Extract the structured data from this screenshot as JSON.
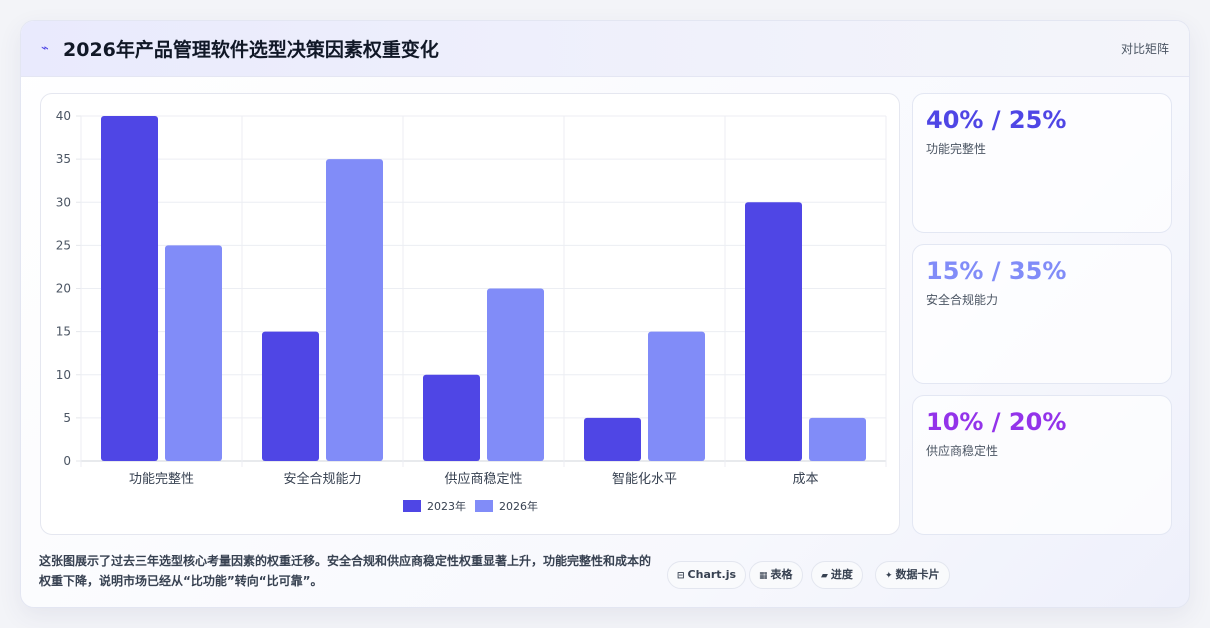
{
  "header": {
    "icon": "trend-line-icon",
    "title": "2026年产品管理软件选型决策因素权重变化",
    "link_label": "对比矩阵"
  },
  "chart_data": {
    "type": "bar",
    "categories": [
      "功能完整性",
      "安全合规能力",
      "供应商稳定性",
      "智能化水平",
      "成本"
    ],
    "series": [
      {
        "name": "2023年",
        "values": [
          40,
          15,
          10,
          5,
          30
        ],
        "color": "#4f46e5"
      },
      {
        "name": "2026年",
        "values": [
          25,
          35,
          20,
          15,
          5
        ],
        "color": "#818cf8"
      }
    ],
    "ylim": [
      0,
      40
    ],
    "yticks": [
      0,
      5,
      10,
      15,
      20,
      25,
      30,
      35,
      40
    ],
    "grid": true,
    "legend": "bottom"
  },
  "stats": [
    {
      "value": "40% / 25%",
      "label": "功能完整性",
      "color": "#4f46e5"
    },
    {
      "value": "15% / 35%",
      "label": "安全合规能力",
      "color": "#818cf8"
    },
    {
      "value": "10% / 20%",
      "label": "供应商稳定性",
      "color": "#9333ea"
    }
  ],
  "description": "这张图展示了过去三年选型核心考量因素的权重迁移。安全合规和供应商稳定性权重显著上升，功能完整性和成本的权重下降，说明市场已经从“比功能”转向“比可靠”。",
  "pills": [
    {
      "icon": "⊟",
      "icon_name": "chart-icon",
      "label": "Chart.js"
    },
    {
      "icon": "▦",
      "icon_name": "table-icon",
      "label": "表格"
    },
    {
      "icon": "▰",
      "icon_name": "progress-icon",
      "label": "进度"
    },
    {
      "icon": "✦",
      "icon_name": "sparkle-icon",
      "label": "数据卡片"
    }
  ]
}
